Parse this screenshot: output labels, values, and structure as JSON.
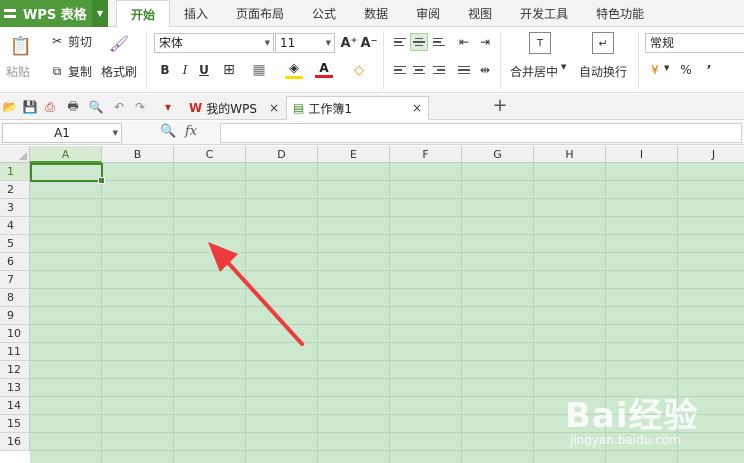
{
  "app": {
    "name": "WPS 表格"
  },
  "ribbon_tabs": [
    "开始",
    "插入",
    "页面布局",
    "公式",
    "数据",
    "审阅",
    "视图",
    "开发工具",
    "特色功能"
  ],
  "ribbon": {
    "paste": "粘贴",
    "cut": "剪切",
    "copy": "复制",
    "format_painter": "格式刷",
    "font_name": "宋体",
    "font_size": "11",
    "bold": "B",
    "italic": "I",
    "underline": "U",
    "merge_center": "合并居中",
    "wrap_text": "自动换行",
    "number_format": "常规",
    "percent": "%",
    "comma": "’",
    "font_color_letter": "A",
    "grow_font": "A⁺",
    "shrink_font": "A⁻",
    "accent_color": "#4f9a3a"
  },
  "doc_tabs": [
    {
      "label": "我的WPS",
      "close": "×"
    },
    {
      "label": "工作簿1",
      "close": "×"
    }
  ],
  "new_tab": "+",
  "formula_bar": {
    "name_box": "A1",
    "fx": "fx",
    "value": ""
  },
  "columns": [
    "A",
    "B",
    "C",
    "D",
    "E",
    "F",
    "G",
    "H",
    "I",
    "J"
  ],
  "rows": [
    "1",
    "2",
    "3",
    "4",
    "5",
    "6",
    "7",
    "8",
    "9",
    "10",
    "11",
    "12",
    "13",
    "14",
    "15",
    "16"
  ],
  "selected_cell": "A1",
  "watermark": {
    "text": "Bai经验",
    "url": "jingyan.baidu.com"
  }
}
